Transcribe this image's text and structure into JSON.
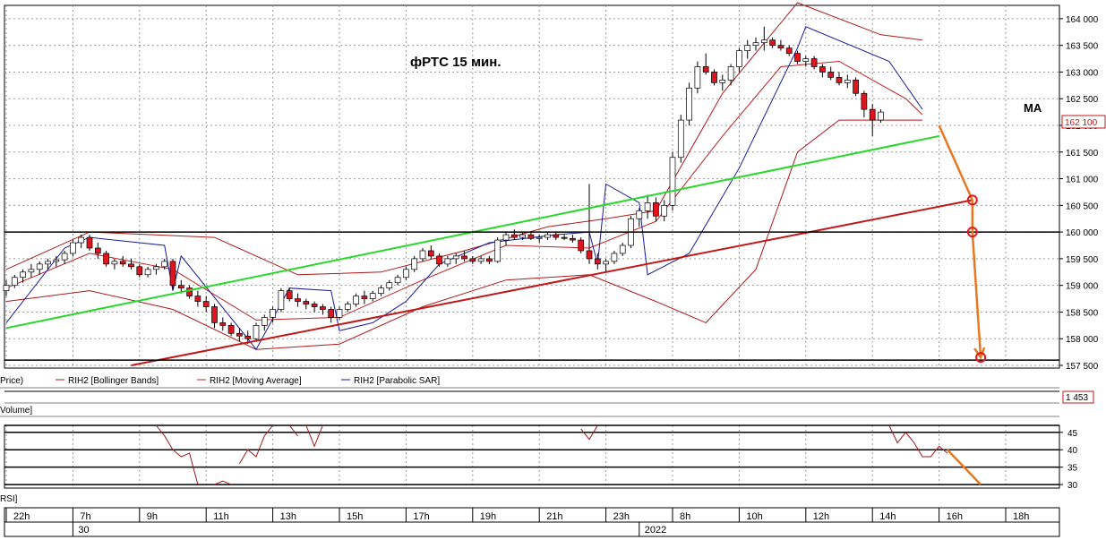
{
  "chart_data": [
    {
      "type": "candlestick",
      "title": "фРТС   15 мин.",
      "y_ticks": [
        157500,
        158000,
        158500,
        159000,
        159500,
        160000,
        160500,
        161000,
        161500,
        162000,
        162500,
        163000,
        163500,
        164000
      ],
      "y_tick_labels": [
        "157 500",
        "158 000",
        "158 500",
        "159 000",
        "159 500",
        "160 000",
        "160 500",
        "161 000",
        "161 500",
        "162 000",
        "162 500",
        "163 000",
        "163 500",
        "164 000"
      ],
      "ylim": [
        157450,
        164250
      ],
      "last_price_label": "162 100",
      "annotation": "MA",
      "legend": [
        "Price)",
        "RIH2 [Bollinger Bands]",
        "RIH2 [Moving Average]",
        "RIH2 [Parabolic SAR]"
      ],
      "colors": {
        "up": "#ffffff",
        "down": "#e0141e",
        "bollinger": "#b01818",
        "ma": "#c02020",
        "sar": "#1a1a9c",
        "uptrend": "#28d828",
        "support": "#c01818",
        "target": "#e87820"
      },
      "candles": [
        [
          158900,
          159100,
          158800,
          159000
        ],
        [
          159000,
          159200,
          158950,
          159150
        ],
        [
          159150,
          159300,
          159050,
          159250
        ],
        [
          159250,
          159400,
          159150,
          159300
        ],
        [
          159300,
          159450,
          159200,
          159400
        ],
        [
          159400,
          159500,
          159300,
          159450
        ],
        [
          159450,
          159550,
          159350,
          159480
        ],
        [
          159480,
          159650,
          159400,
          159600
        ],
        [
          159600,
          159850,
          159550,
          159800
        ],
        [
          159800,
          159950,
          159700,
          159900
        ],
        [
          159900,
          159950,
          159650,
          159700
        ],
        [
          159700,
          159800,
          159500,
          159600
        ],
        [
          159600,
          159650,
          159350,
          159400
        ],
        [
          159400,
          159500,
          159300,
          159450
        ],
        [
          159450,
          159550,
          159350,
          159400
        ],
        [
          159400,
          159500,
          159300,
          159350
        ],
        [
          159350,
          159400,
          159150,
          159200
        ],
        [
          159200,
          159350,
          159150,
          159300
        ],
        [
          159300,
          159400,
          159200,
          159350
        ],
        [
          159350,
          159500,
          159300,
          159450
        ],
        [
          159450,
          159500,
          158900,
          159000
        ],
        [
          159000,
          159100,
          158850,
          158950
        ],
        [
          158950,
          159000,
          158750,
          158800
        ],
        [
          158800,
          158900,
          158600,
          158700
        ],
        [
          158700,
          158800,
          158500,
          158600
        ],
        [
          158600,
          158650,
          158200,
          158300
        ],
        [
          158300,
          158400,
          158150,
          158250
        ],
        [
          158250,
          158300,
          158050,
          158100
        ],
        [
          158100,
          158200,
          157950,
          158050
        ],
        [
          158050,
          158150,
          157900,
          158000
        ],
        [
          158000,
          158300,
          157950,
          158250
        ],
        [
          158250,
          158450,
          158150,
          158400
        ],
        [
          158400,
          158600,
          158300,
          158550
        ],
        [
          158550,
          158950,
          158500,
          158900
        ],
        [
          158900,
          158950,
          158700,
          158750
        ],
        [
          158750,
          158850,
          158600,
          158700
        ],
        [
          158700,
          158750,
          158550,
          158650
        ],
        [
          158650,
          158700,
          158500,
          158600
        ],
        [
          158600,
          158650,
          158450,
          158550
        ],
        [
          158550,
          158600,
          158300,
          158400
        ],
        [
          158400,
          158600,
          158350,
          158550
        ],
        [
          158550,
          158700,
          158500,
          158650
        ],
        [
          158650,
          158850,
          158600,
          158800
        ],
        [
          158800,
          158900,
          158650,
          158750
        ],
        [
          158750,
          158900,
          158700,
          158850
        ],
        [
          158850,
          159000,
          158800,
          158950
        ],
        [
          158950,
          159100,
          158900,
          159050
        ],
        [
          159050,
          159200,
          159000,
          159150
        ],
        [
          159150,
          159350,
          159100,
          159300
        ],
        [
          159300,
          159550,
          159250,
          159500
        ],
        [
          159500,
          159700,
          159450,
          159650
        ],
        [
          159650,
          159750,
          159500,
          159550
        ],
        [
          159550,
          159600,
          159350,
          159400
        ],
        [
          159400,
          159550,
          159350,
          159500
        ],
        [
          159500,
          159600,
          159400,
          159550
        ],
        [
          159550,
          159650,
          159450,
          159500
        ],
        [
          159500,
          159550,
          159400,
          159450
        ],
        [
          159450,
          159550,
          159400,
          159500
        ],
        [
          159500,
          159550,
          159400,
          159450
        ],
        [
          159450,
          159900,
          159420,
          159850
        ],
        [
          159850,
          160000,
          159750,
          159950
        ],
        [
          159950,
          160050,
          159850,
          159900
        ],
        [
          159900,
          160000,
          159850,
          159950
        ],
        [
          159950,
          160000,
          159850,
          159880
        ],
        [
          159880,
          159950,
          159800,
          159900
        ],
        [
          159900,
          160000,
          159850,
          159950
        ],
        [
          159950,
          160000,
          159850,
          159900
        ],
        [
          159900,
          159950,
          159850,
          159880
        ],
        [
          159880,
          159950,
          159800,
          159850
        ],
        [
          159850,
          159900,
          159600,
          159650
        ],
        [
          159650,
          160900,
          159400,
          159500
        ],
        [
          159500,
          159600,
          159300,
          159400
        ],
        [
          159400,
          159500,
          159250,
          159450
        ],
        [
          159450,
          159650,
          159400,
          159600
        ],
        [
          159600,
          159800,
          159550,
          159750
        ],
        [
          159750,
          160300,
          159700,
          160250
        ],
        [
          160250,
          160450,
          160100,
          160400
        ],
        [
          160400,
          160700,
          160250,
          160550
        ],
        [
          160550,
          160650,
          160200,
          160300
        ],
        [
          160300,
          160600,
          160200,
          160500
        ],
        [
          160500,
          161500,
          160400,
          161400
        ],
        [
          161400,
          162200,
          161300,
          162100
        ],
        [
          162100,
          162800,
          162000,
          162700
        ],
        [
          162700,
          163200,
          162600,
          163100
        ],
        [
          163100,
          163350,
          162950,
          163000
        ],
        [
          163000,
          163050,
          162750,
          162800
        ],
        [
          162800,
          162950,
          162650,
          162850
        ],
        [
          162850,
          163150,
          162750,
          163100
        ],
        [
          163100,
          163450,
          163000,
          163400
        ],
        [
          163400,
          163600,
          163250,
          163500
        ],
        [
          163500,
          163650,
          163400,
          163550
        ],
        [
          163550,
          163850,
          163400,
          163600
        ],
        [
          163600,
          163650,
          163450,
          163500
        ],
        [
          163500,
          163600,
          163400,
          163450
        ],
        [
          163450,
          163500,
          163300,
          163350
        ],
        [
          163350,
          163400,
          163150,
          163200
        ],
        [
          163200,
          163300,
          163100,
          163250
        ],
        [
          163250,
          163300,
          163050,
          163100
        ],
        [
          163100,
          163150,
          162900,
          163000
        ],
        [
          163000,
          163100,
          162850,
          162900
        ],
        [
          162900,
          163000,
          162750,
          162800
        ],
        [
          162800,
          162950,
          162700,
          162850
        ],
        [
          162850,
          162900,
          162550,
          162600
        ],
        [
          162600,
          162650,
          162150,
          162300
        ],
        [
          162300,
          162400,
          161800,
          162100
        ],
        [
          162100,
          162300,
          162050,
          162250
        ]
      ],
      "bollinger_upper": [
        [
          0,
          159300
        ],
        [
          10,
          160000
        ],
        [
          25,
          159900
        ],
        [
          35,
          159200
        ],
        [
          45,
          159250
        ],
        [
          55,
          159650
        ],
        [
          65,
          160100
        ],
        [
          72,
          160250
        ],
        [
          78,
          160400
        ],
        [
          86,
          162600
        ],
        [
          95,
          164300
        ],
        [
          105,
          163700
        ],
        [
          110,
          163600
        ]
      ],
      "bollinger_lower": [
        [
          0,
          158700
        ],
        [
          10,
          158900
        ],
        [
          20,
          158550
        ],
        [
          30,
          157800
        ],
        [
          40,
          157900
        ],
        [
          50,
          158600
        ],
        [
          60,
          159100
        ],
        [
          70,
          159200
        ],
        [
          78,
          158700
        ],
        [
          84,
          158300
        ],
        [
          90,
          159300
        ],
        [
          95,
          161500
        ],
        [
          100,
          162100
        ],
        [
          110,
          162100
        ]
      ],
      "moving_average": [
        [
          0,
          158950
        ],
        [
          10,
          159600
        ],
        [
          20,
          159300
        ],
        [
          30,
          158350
        ],
        [
          40,
          158400
        ],
        [
          50,
          159100
        ],
        [
          60,
          159750
        ],
        [
          70,
          159700
        ],
        [
          78,
          160200
        ],
        [
          86,
          161800
        ],
        [
          93,
          163100
        ],
        [
          100,
          163200
        ],
        [
          108,
          162500
        ],
        [
          110,
          162200
        ]
      ],
      "parabolic_sar": [
        [
          0,
          158300
        ],
        [
          7,
          159700
        ],
        [
          10,
          159900
        ],
        [
          19,
          159750
        ],
        [
          20,
          158900
        ],
        [
          21,
          159550
        ],
        [
          29,
          158000
        ],
        [
          30,
          157800
        ],
        [
          34,
          158950
        ],
        [
          39,
          158900
        ],
        [
          40,
          158150
        ],
        [
          44,
          158300
        ],
        [
          48,
          158700
        ],
        [
          52,
          159400
        ],
        [
          58,
          159800
        ],
        [
          66,
          159950
        ],
        [
          70,
          160000
        ],
        [
          71,
          159400
        ],
        [
          72,
          160900
        ],
        [
          76,
          160550
        ],
        [
          77,
          159200
        ],
        [
          82,
          159600
        ],
        [
          88,
          161200
        ],
        [
          95,
          163450
        ],
        [
          96,
          163850
        ],
        [
          106,
          163200
        ],
        [
          110,
          162300
        ]
      ],
      "lines": {
        "uptrend_green": [
          [
            0,
            158200
          ],
          [
            112,
            161800
          ]
        ],
        "support_red": [
          [
            15,
            157500
          ],
          [
            116,
            160600
          ]
        ],
        "level_160000": 160000,
        "level_157600": 157600,
        "target_arrow": [
          [
            112,
            162000
          ],
          [
            116,
            160600
          ],
          [
            116,
            160000
          ],
          [
            117,
            157650
          ]
        ]
      }
    },
    {
      "type": "line",
      "label": "Volume]",
      "value_label": "1 453"
    },
    {
      "type": "line",
      "label": "RSI]",
      "y_ticks": [
        30,
        35,
        40,
        45
      ],
      "ylim": [
        29,
        47
      ],
      "levels": [
        30,
        40,
        45,
        47
      ],
      "dotted_levels": [
        35
      ],
      "segments": [
        [
          [
            18,
            47
          ],
          [
            19,
            44
          ],
          [
            20,
            40
          ],
          [
            21,
            38
          ],
          [
            22,
            39
          ],
          [
            23,
            30
          ]
        ],
        [
          [
            25,
            30
          ],
          [
            26,
            31
          ],
          [
            27,
            30
          ]
        ],
        [
          [
            28,
            36
          ],
          [
            29,
            40
          ],
          [
            30,
            38
          ],
          [
            31,
            44
          ],
          [
            32,
            47
          ]
        ],
        [
          [
            34,
            47
          ],
          [
            35,
            44
          ]
        ],
        [
          [
            36,
            47
          ],
          [
            37,
            41
          ],
          [
            38,
            47
          ]
        ],
        [
          [
            69,
            46
          ],
          [
            70,
            43
          ],
          [
            71,
            47
          ]
        ],
        [
          [
            106,
            47
          ],
          [
            107,
            42
          ],
          [
            108,
            45
          ],
          [
            109,
            42
          ],
          [
            110,
            38
          ],
          [
            111,
            38
          ],
          [
            112,
            41
          ],
          [
            113,
            39
          ]
        ]
      ],
      "target_arrow": [
        [
          113,
          40
        ],
        [
          117,
          30
        ]
      ]
    }
  ],
  "time_axis": {
    "hour_labels": [
      {
        "label": "22h",
        "x": 0
      },
      {
        "label": "7h",
        "x": 8
      },
      {
        "label": "9h",
        "x": 16
      },
      {
        "label": "11h",
        "x": 24
      },
      {
        "label": "13h",
        "x": 32
      },
      {
        "label": "15h",
        "x": 40
      },
      {
        "label": "17h",
        "x": 48
      },
      {
        "label": "19h",
        "x": 56
      },
      {
        "label": "21h",
        "x": 64
      },
      {
        "label": "23h",
        "x": 72
      },
      {
        "label": "8h",
        "x": 80
      },
      {
        "label": "10h",
        "x": 88
      },
      {
        "label": "12h",
        "x": 96
      },
      {
        "label": "14h",
        "x": 104
      },
      {
        "label": "16h",
        "x": 112
      },
      {
        "label": "18h",
        "x": 120
      }
    ],
    "day_labels": [
      {
        "label": "30",
        "x": 8
      },
      {
        "label": "2022",
        "x": 76
      }
    ]
  }
}
